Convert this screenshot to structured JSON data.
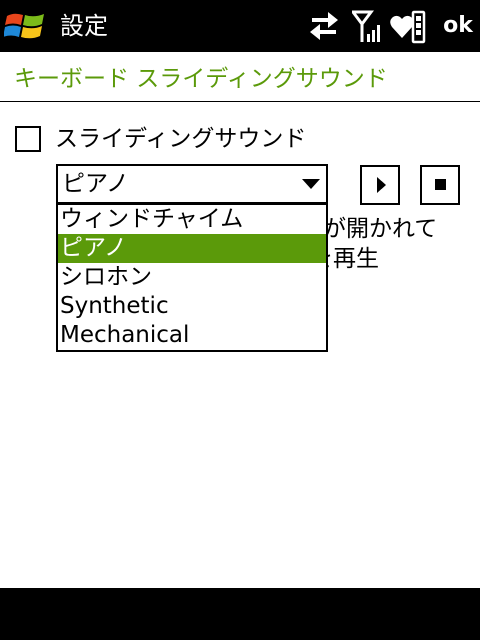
{
  "titlebar": {
    "title": "設定",
    "ok_label": "ok",
    "icons": [
      "windows-start-icon",
      "data-sync-arrows-icon",
      "signal-strength-icon",
      "battery-heart-icon"
    ]
  },
  "page": {
    "heading": "キーボード スライディングサウンド"
  },
  "settings": {
    "checkbox_label": "スライディングサウンド",
    "checkbox_checked": false,
    "selected_sound": "ピアノ",
    "description_line1_visible": "ドが開かれて",
    "description_line2_visible": "を再生"
  },
  "dropdown": {
    "options": [
      "ウィンドチャイム",
      "ピアノ",
      "シロホン",
      "Synthetic",
      "Mechanical"
    ],
    "selected_index": 1
  },
  "colors": {
    "accent": "#5b9a0a",
    "titlebar_bg": "#000000",
    "background": "#ffffff"
  }
}
